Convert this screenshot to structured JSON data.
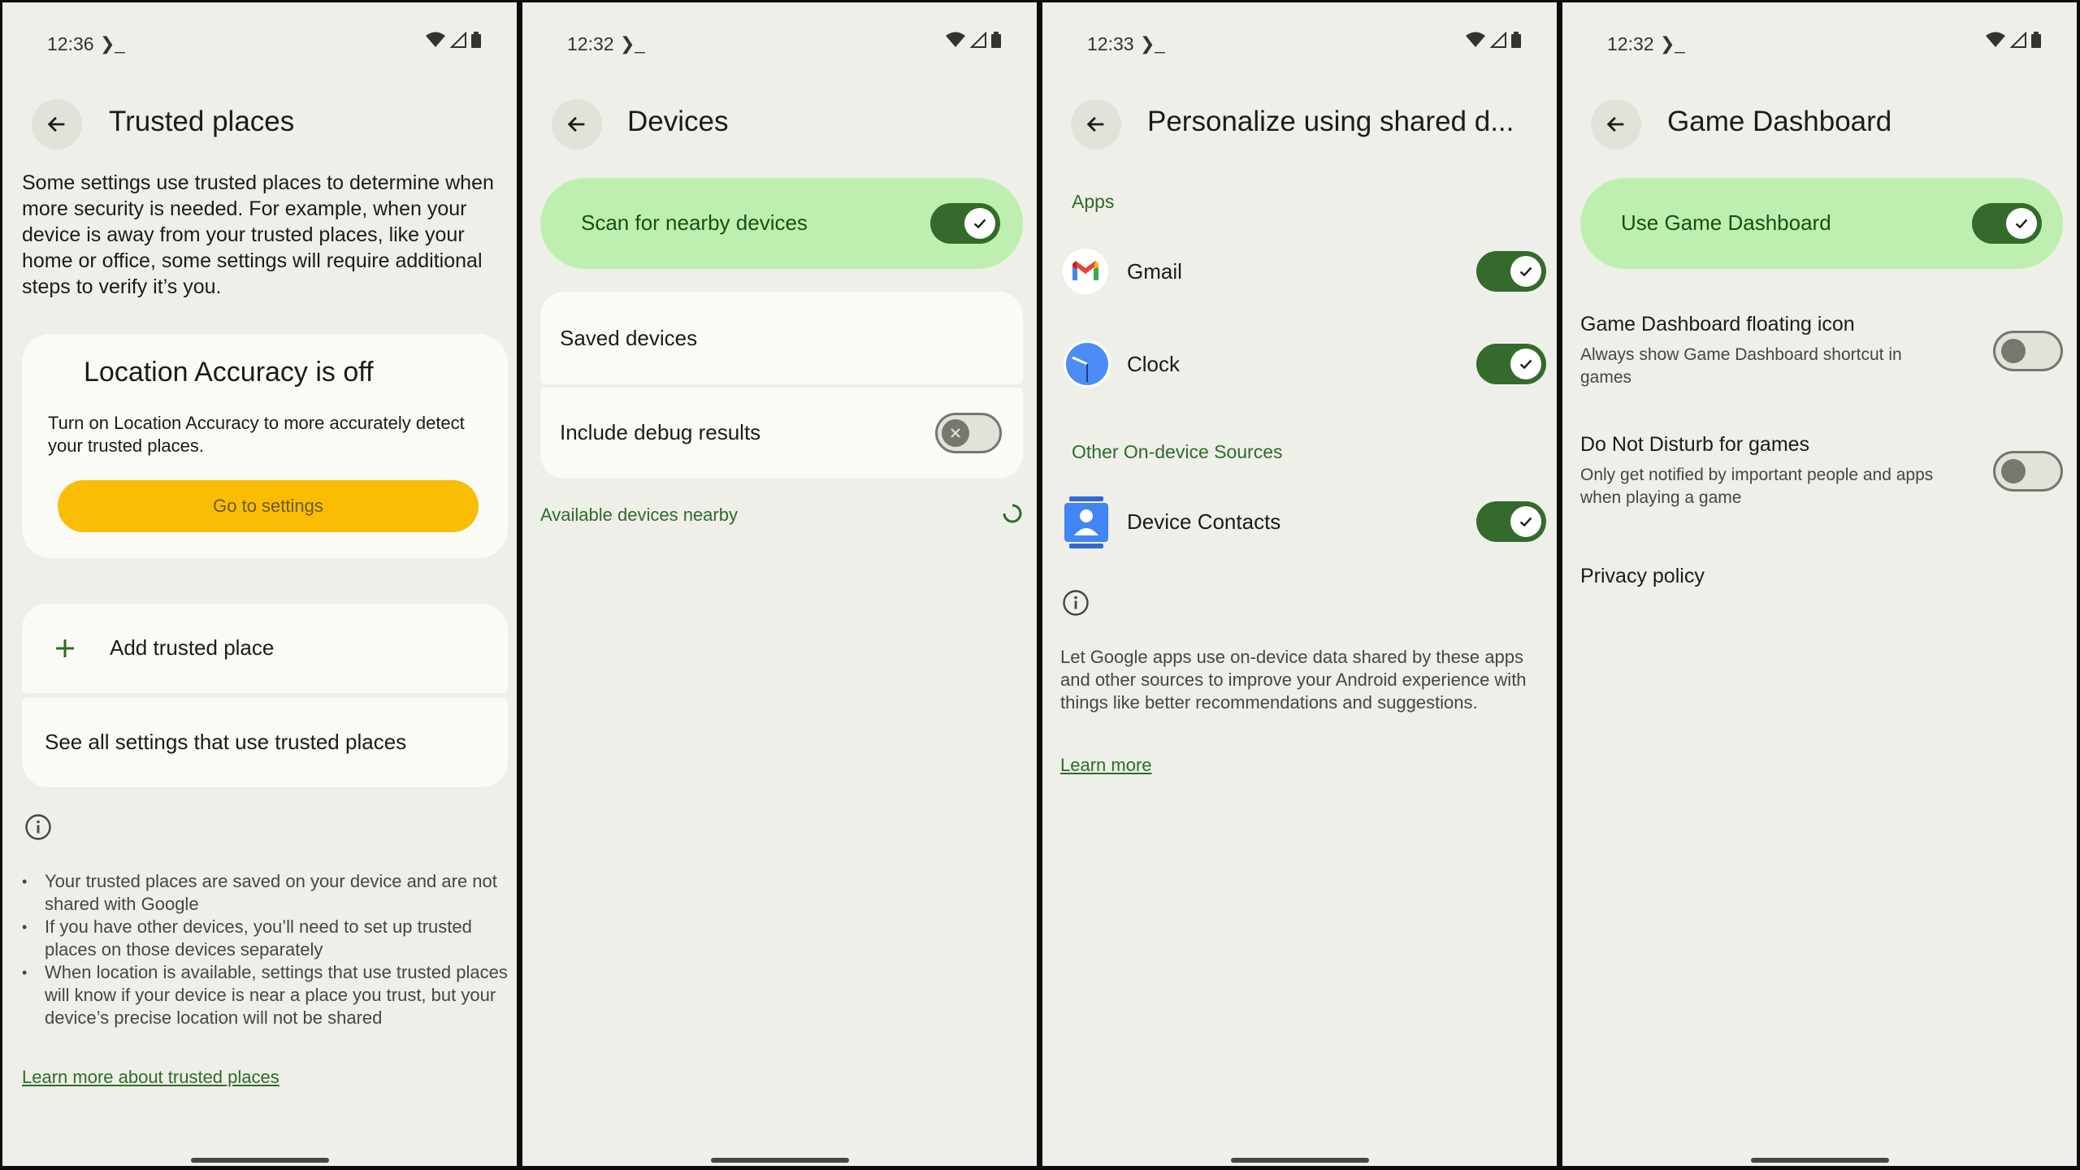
{
  "panels": {
    "trusted": {
      "time": "12:36",
      "title": "Trusted places",
      "intro": "Some settings use trusted places to determine when more security is needed. For example, when your device is away from your trusted places, like your home or office, some settings will require additional steps to verify it’s you.",
      "location_card": {
        "heading": "Location Accuracy is off",
        "body": "Turn on Location Accuracy to more accurately detect your trusted places.",
        "button": "Go to settings"
      },
      "add_label": "Add trusted place",
      "see_all_label": "See all settings that use trusted places",
      "bullets": [
        "Your trusted places are saved on your device and are not shared with Google",
        "If you have other devices, you’ll need to set up trusted places on those devices separately",
        "When location is available, settings that use trusted places will know if your device is near a place you trust, but your device’s precise location will not be shared"
      ],
      "learn_more": "Learn more about trusted places"
    },
    "devices": {
      "time": "12:32",
      "title": "Devices",
      "scan_label": "Scan for nearby devices",
      "saved_label": "Saved devices",
      "debug_label": "Include debug results",
      "available_label": "Available devices nearby"
    },
    "personalize": {
      "time": "12:33",
      "title": "Personalize using shared d...",
      "apps_header": "Apps",
      "gmail_label": "Gmail",
      "clock_label": "Clock",
      "other_header": "Other On-device Sources",
      "contacts_label": "Device Contacts",
      "description": "Let Google apps use on-device data shared by these apps and other sources to improve your Android experience with things like better recommendations and suggestions.",
      "learn_more": "Learn more"
    },
    "game": {
      "time": "12:32",
      "title": "Game Dashboard",
      "use_label": "Use Game Dashboard",
      "floating_title": "Game Dashboard floating icon",
      "floating_sub": "Always show Game Dashboard shortcut in games",
      "dnd_title": "Do Not Disturb for games",
      "dnd_sub": "Only get notified by important people and apps when playing a game",
      "privacy": "Privacy policy"
    }
  },
  "colors": {
    "background": "#eeefe8",
    "card": "#fbfbf6",
    "primary": "#346a2c",
    "primary_container": "#bdf0b0",
    "amber_button": "#fbbc04"
  },
  "toggles": {
    "scan": "on",
    "debug": "off",
    "gmail": "on",
    "clock": "on",
    "contacts": "on",
    "game_dashboard": "on",
    "floating_icon": "off",
    "dnd": "off"
  }
}
